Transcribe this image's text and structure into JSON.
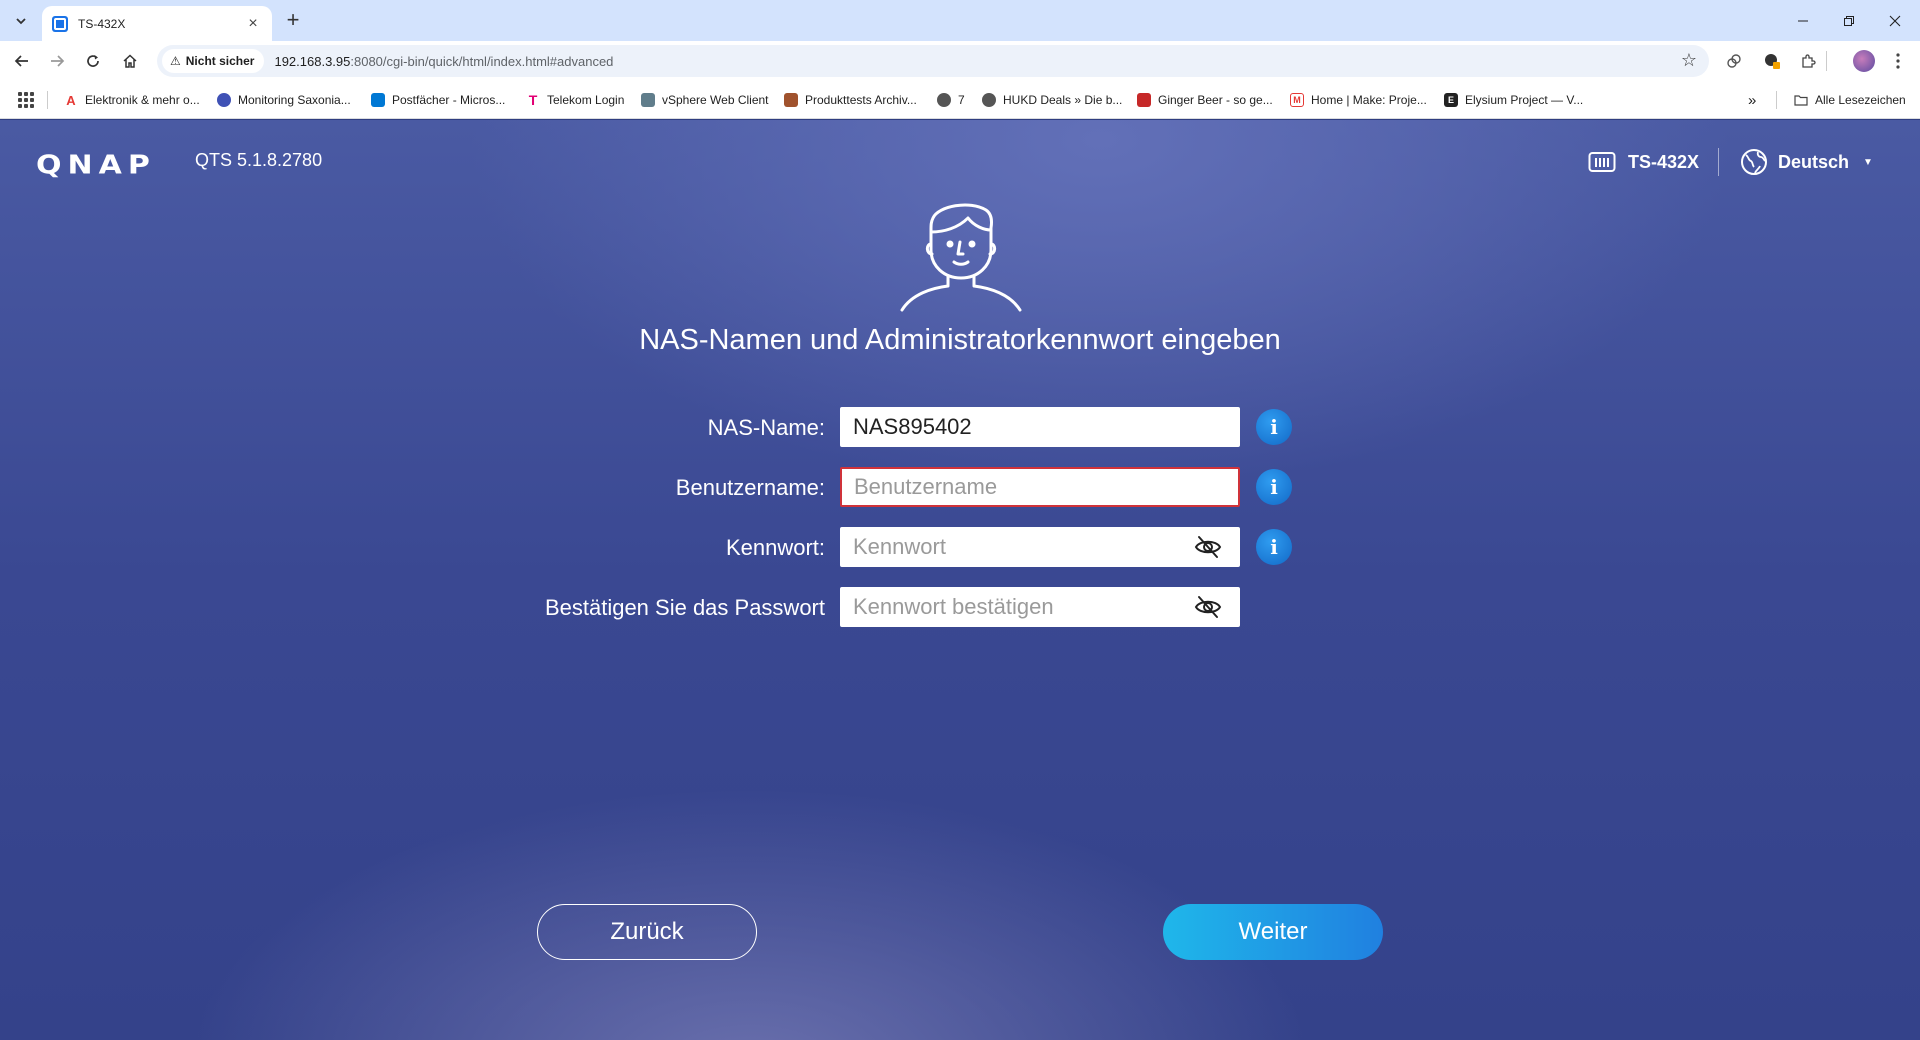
{
  "browser": {
    "tab_title": "TS-432X",
    "security_label": "Nicht sicher",
    "url_host": "192.168.3.95",
    "url_rest": ":8080/cgi-bin/quick/html/index.html#advanced",
    "bookmarks": [
      {
        "label": "Elektronik & mehr o...",
        "icon_color": "#e53935"
      },
      {
        "label": "Monitoring Saxonia...",
        "icon_color": "#3f51b5"
      },
      {
        "label": "Postfächer - Micros...",
        "icon_color": "#0078d4"
      },
      {
        "label": "Telekom Login",
        "icon_color": "#e20074"
      },
      {
        "label": "vSphere Web Client",
        "icon_color": "#607d8b"
      },
      {
        "label": "Produkttests Archiv...",
        "icon_color": "#a0522d"
      },
      {
        "label": "7",
        "icon_color": "#555555"
      },
      {
        "label": "HUKD Deals » Die b...",
        "icon_color": "#555555"
      },
      {
        "label": "Ginger Beer - so ge...",
        "icon_color": "#c62828"
      },
      {
        "label": "Home | Make: Proje...",
        "icon_color": "#e53935"
      },
      {
        "label": "Elysium Project — V...",
        "icon_color": "#222222"
      }
    ],
    "all_bookmarks_label": "Alle Lesezeichen",
    "overflow_label": "»"
  },
  "header": {
    "logo": "QNAP",
    "version": "QTS 5.1.8.2780",
    "model": "TS-432X",
    "language": "Deutsch"
  },
  "main": {
    "headline": "NAS-Namen und Administratorkennwort eingeben",
    "fields": {
      "nas_name": {
        "label": "NAS-Name:",
        "value": "NAS895402",
        "placeholder": ""
      },
      "username": {
        "label": "Benutzername:",
        "value": "",
        "placeholder": "Benutzername"
      },
      "password": {
        "label": "Kennwort:",
        "value": "",
        "placeholder": "Kennwort"
      },
      "confirm": {
        "label": "Bestätigen Sie das Passwort",
        "value": "",
        "placeholder": "Kennwort bestätigen"
      }
    },
    "info_glyph": "i"
  },
  "buttons": {
    "back": "Zurück",
    "next": "Weiter"
  },
  "colors": {
    "accent": "#1fb7ea",
    "error_border": "#d0333a",
    "info_blue": "#1a7fd8"
  }
}
